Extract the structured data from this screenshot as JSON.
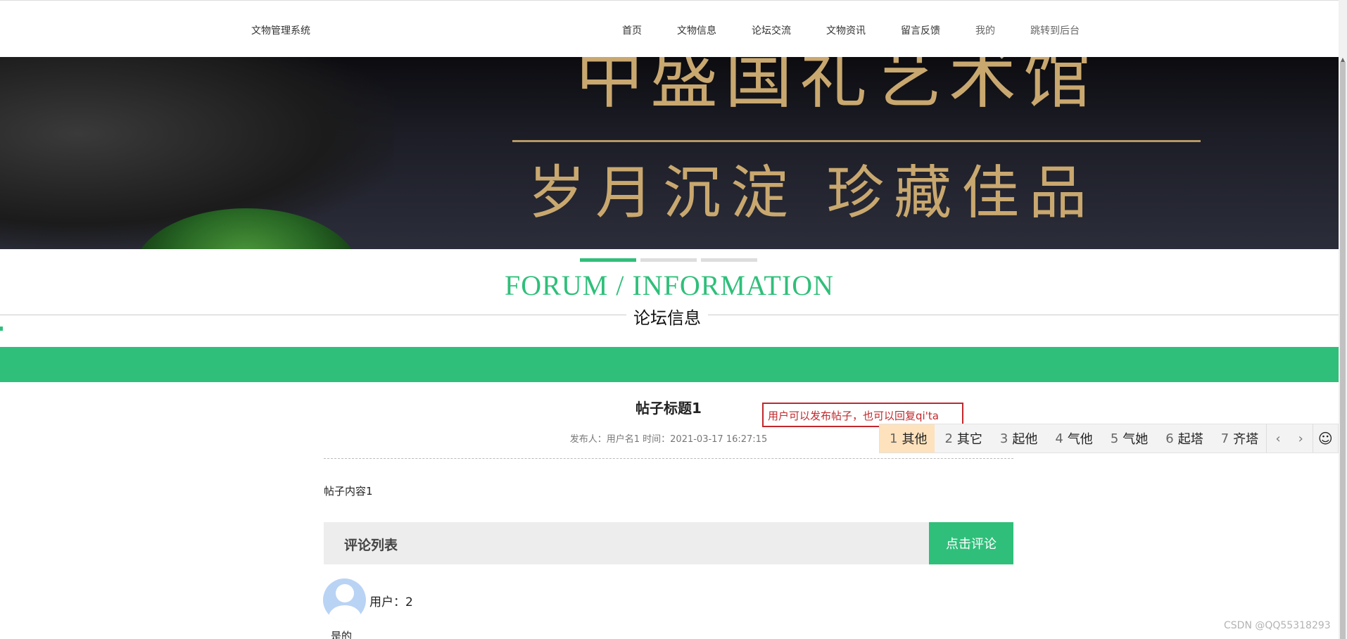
{
  "header": {
    "brand": "文物管理系统",
    "nav": [
      "首页",
      "文物信息",
      "论坛交流",
      "文物资讯",
      "留言反馈",
      "我的",
      "跳转到后台"
    ]
  },
  "banner": {
    "line1": "中盛国礼艺术馆",
    "line2": "岁月沉淀  珍藏佳品"
  },
  "section": {
    "title_en": "FORUM / INFORMATION",
    "title_cn": "论坛信息"
  },
  "post": {
    "title": "帖子标题1",
    "meta": "发布人：用户名1 时间：2021-03-17 16:27:15",
    "content": "帖子内容1"
  },
  "comments": {
    "header": "评论列表",
    "button": "点击评论",
    "items": [
      {
        "user": "用户：2",
        "text": "是的"
      }
    ]
  },
  "annotation": {
    "text": "用户可以发布帖子，也可以回复qi'ta"
  },
  "ime": {
    "candidates": [
      {
        "n": "1",
        "text": "其他"
      },
      {
        "n": "2",
        "text": "其它"
      },
      {
        "n": "3",
        "text": "起他"
      },
      {
        "n": "4",
        "text": "气他"
      },
      {
        "n": "5",
        "text": "气她"
      },
      {
        "n": "6",
        "text": "起塔"
      },
      {
        "n": "7",
        "text": "齐塔"
      }
    ],
    "prev_icon": "chevron-left-icon",
    "next_icon": "chevron-right-icon",
    "emoji_icon": "smiley-icon"
  },
  "watermark": "CSDN @QQ55318293",
  "colors": {
    "accent": "#2fbf7a",
    "annotation": "#c0282d"
  }
}
